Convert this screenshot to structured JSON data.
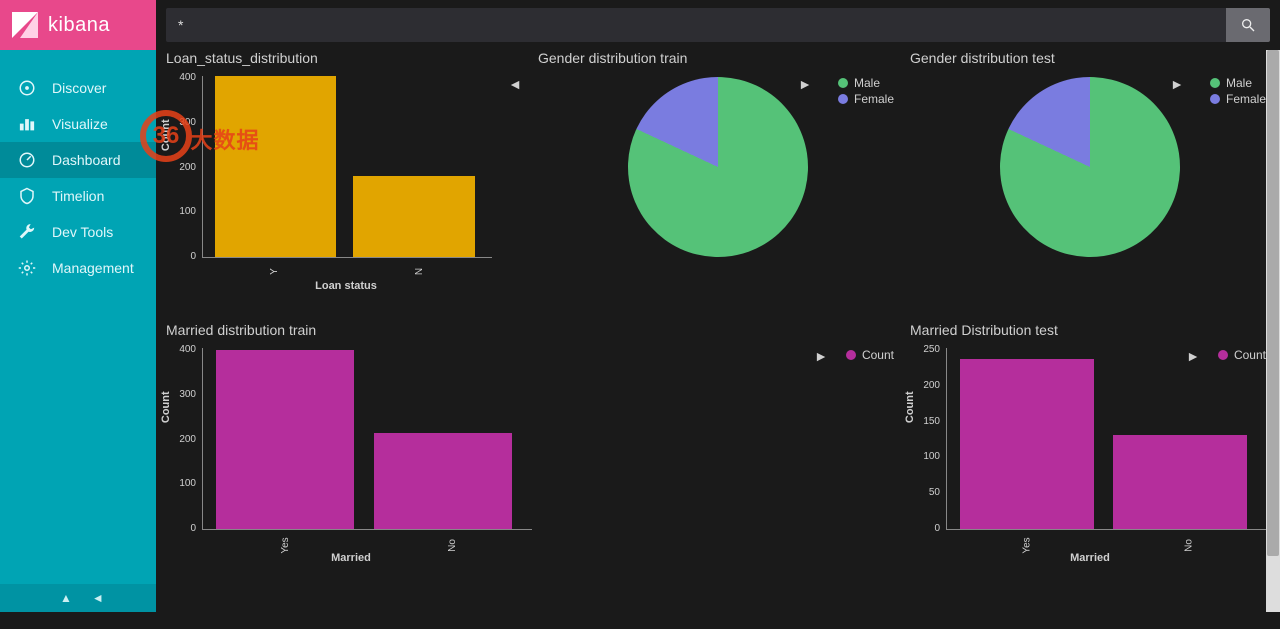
{
  "brand": {
    "name": "kibana"
  },
  "sidebar": {
    "items": [
      {
        "label": "Discover"
      },
      {
        "label": "Visualize"
      },
      {
        "label": "Dashboard"
      },
      {
        "label": "Timelion"
      },
      {
        "label": "Dev Tools"
      },
      {
        "label": "Management"
      }
    ]
  },
  "search": {
    "value": "*"
  },
  "watermark": {
    "badge": "36",
    "text": "大数据"
  },
  "colors": {
    "bar_gold": "#E1A500",
    "bar_magenta": "#B52E9C",
    "pie_green": "#55C278",
    "pie_purple": "#7A7CE0"
  },
  "panels": {
    "loan_status": {
      "title": "Loan_status_distribution",
      "ylabel": "Count",
      "xlabel": "Loan status"
    },
    "gender_train": {
      "title": "Gender distribution train",
      "legend": [
        "Male",
        "Female"
      ]
    },
    "gender_test": {
      "title": "Gender distribution test",
      "legend": [
        "Male",
        "Female"
      ]
    },
    "married_train": {
      "title": "Married distribution train",
      "ylabel": "Count",
      "xlabel": "Married",
      "legend": [
        "Count"
      ]
    },
    "married_test": {
      "title": "Married Distribution test",
      "ylabel": "Count",
      "xlabel": "Married",
      "legend": [
        "Count"
      ]
    }
  },
  "chart_data": [
    {
      "id": "loan_status",
      "type": "bar",
      "title": "Loan_status_distribution",
      "categories": [
        "Y",
        "N"
      ],
      "values": [
        420,
        190
      ],
      "ylabel": "Count",
      "xlabel": "Loan status",
      "ylim": [
        0,
        420
      ],
      "y_ticks": [
        0,
        100,
        200,
        300,
        400
      ],
      "color": "#E1A500"
    },
    {
      "id": "gender_train",
      "type": "pie",
      "title": "Gender distribution train",
      "series": [
        {
          "name": "Male",
          "value": 82,
          "color": "#55C278"
        },
        {
          "name": "Female",
          "value": 18,
          "color": "#7A7CE0"
        }
      ]
    },
    {
      "id": "gender_test",
      "type": "pie",
      "title": "Gender distribution test",
      "series": [
        {
          "name": "Male",
          "value": 82,
          "color": "#55C278"
        },
        {
          "name": "Female",
          "value": 18,
          "color": "#7A7CE0"
        }
      ]
    },
    {
      "id": "married_train",
      "type": "bar",
      "title": "Married distribution train",
      "categories": [
        "Yes",
        "No"
      ],
      "values": [
        395,
        210
      ],
      "ylabel": "Count",
      "xlabel": "Married",
      "ylim": [
        0,
        400
      ],
      "y_ticks": [
        0,
        100,
        200,
        300,
        400
      ],
      "color": "#B52E9C",
      "legend": [
        "Count"
      ]
    },
    {
      "id": "married_test",
      "type": "bar",
      "title": "Married Distribution test",
      "categories": [
        "Yes",
        "No"
      ],
      "values": [
        235,
        130
      ],
      "ylabel": "Count",
      "xlabel": "Married",
      "ylim": [
        0,
        250
      ],
      "y_ticks": [
        0,
        50,
        100,
        150,
        200,
        250
      ],
      "color": "#B52E9C",
      "legend": [
        "Count"
      ]
    }
  ]
}
